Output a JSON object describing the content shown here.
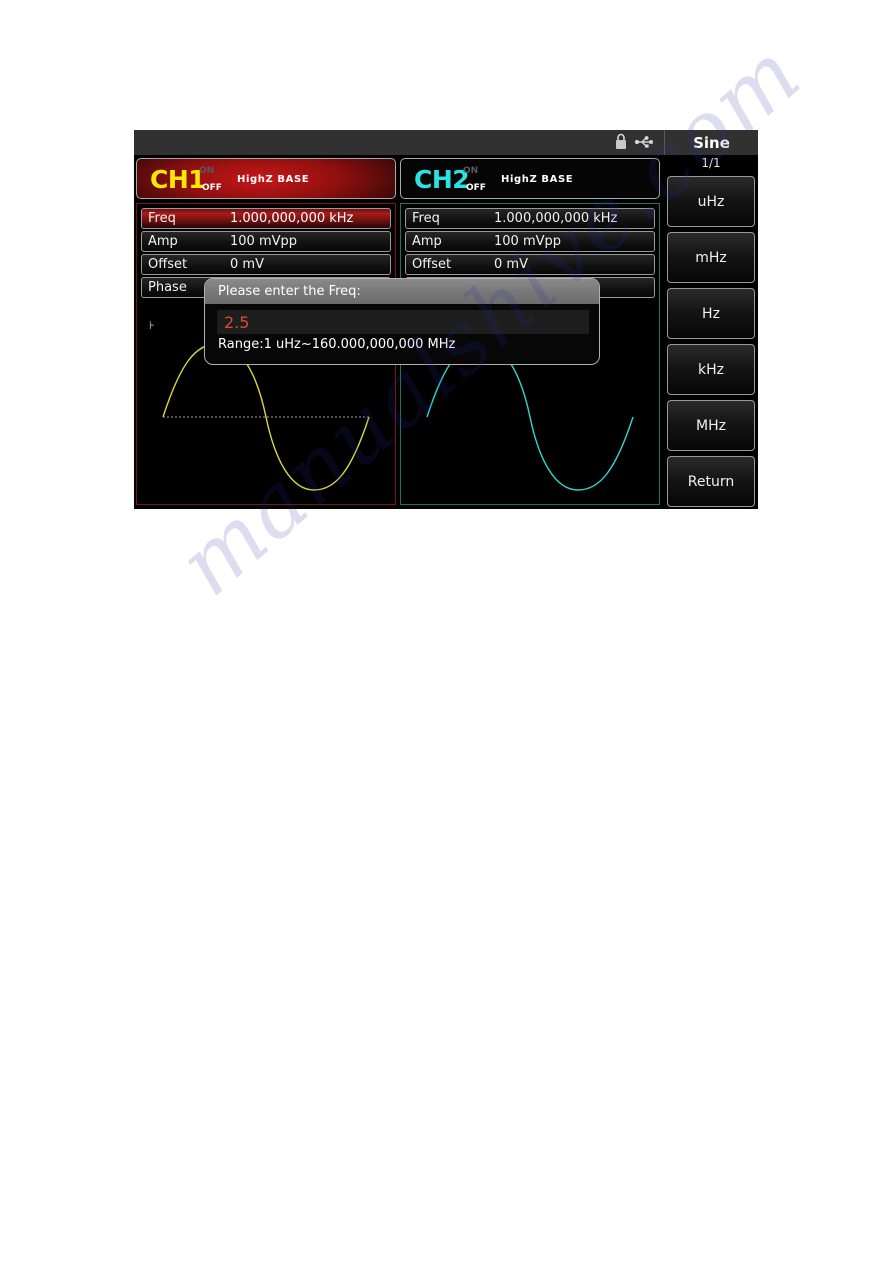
{
  "watermark": {
    "text": "manualshive.com"
  },
  "statusbar": {
    "icons": [
      {
        "name": "lock-icon",
        "label": "lock"
      },
      {
        "name": "usb-icon",
        "label": "usb"
      }
    ]
  },
  "menu": {
    "title": "Sine",
    "page": "1/1",
    "buttons": [
      {
        "label": "uHz"
      },
      {
        "label": "mHz"
      },
      {
        "label": "Hz"
      },
      {
        "label": "kHz"
      },
      {
        "label": "MHz"
      },
      {
        "label": "Return"
      }
    ]
  },
  "channels": [
    {
      "name": "CH1",
      "on_label": "ON",
      "off_label": "OFF",
      "impedance": "HighZ BASE",
      "color": "#ffe800",
      "params": [
        {
          "label": "Freq",
          "value": "1.000,000,000 kHz",
          "highlighted": true
        },
        {
          "label": "Amp",
          "value": "100 mVpp",
          "highlighted": false
        },
        {
          "label": "Offset",
          "value": "0 mV",
          "highlighted": false
        },
        {
          "label": "Phase",
          "value": "",
          "highlighted": false
        }
      ],
      "waveform": {
        "type": "sine",
        "marker": "⊦"
      }
    },
    {
      "name": "CH2",
      "on_label": "ON",
      "off_label": "OFF",
      "impedance": "HighZ BASE",
      "color": "#2ae2e2",
      "params": [
        {
          "label": "Freq",
          "value": "1.000,000,000 kHz",
          "highlighted": false
        },
        {
          "label": "Amp",
          "value": "100 mVpp",
          "highlighted": false
        },
        {
          "label": "Offset",
          "value": "0 mV",
          "highlighted": false
        },
        {
          "label": "",
          "value": "",
          "highlighted": false
        }
      ],
      "waveform": {
        "type": "sine",
        "marker": ""
      }
    }
  ],
  "dialog": {
    "title": "Please enter the Freq:",
    "input_value": "2.5",
    "range_text": "Range:1 uHz~160.000,000,000 MHz"
  }
}
